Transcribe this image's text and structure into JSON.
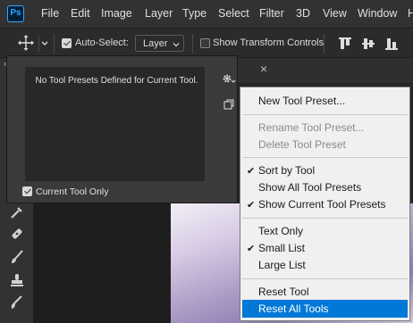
{
  "menubar": {
    "logo": "Ps",
    "items": [
      "File",
      "Edit",
      "Image",
      "Layer",
      "Type",
      "Select",
      "Filter",
      "3D",
      "View",
      "Window",
      "H"
    ]
  },
  "options": {
    "auto_select_label": "Auto-Select:",
    "auto_select_checked": true,
    "layer_select_value": "Layer",
    "show_transform_label": "Show Transform Controls",
    "show_transform_checked": false
  },
  "preset_panel": {
    "empty_message": "No Tool Presets Defined for Current Tool.",
    "current_tool_only_label": "Current Tool Only",
    "current_tool_only_checked": true
  },
  "doc_tab": {
    "close_glyph": "×"
  },
  "context_menu": {
    "items": [
      {
        "label": "New Tool Preset...",
        "enabled": true,
        "checked": false
      },
      {
        "label": "Rename Tool Preset...",
        "enabled": false,
        "checked": false
      },
      {
        "label": "Delete Tool Preset",
        "enabled": false,
        "checked": false
      },
      {
        "label": "Sort by Tool",
        "enabled": true,
        "checked": true
      },
      {
        "label": "Show All Tool Presets",
        "enabled": true,
        "checked": false
      },
      {
        "label": "Show Current Tool Presets",
        "enabled": true,
        "checked": true
      },
      {
        "label": "Text Only",
        "enabled": true,
        "checked": false
      },
      {
        "label": "Small List",
        "enabled": true,
        "checked": true
      },
      {
        "label": "Large List",
        "enabled": true,
        "checked": false
      },
      {
        "label": "Reset Tool",
        "enabled": true,
        "checked": false
      },
      {
        "label": "Reset All Tools",
        "enabled": true,
        "checked": false,
        "highlighted": true
      }
    ]
  },
  "colors": {
    "accent": "#0078d7",
    "ps_blue": "#31a8ff"
  }
}
